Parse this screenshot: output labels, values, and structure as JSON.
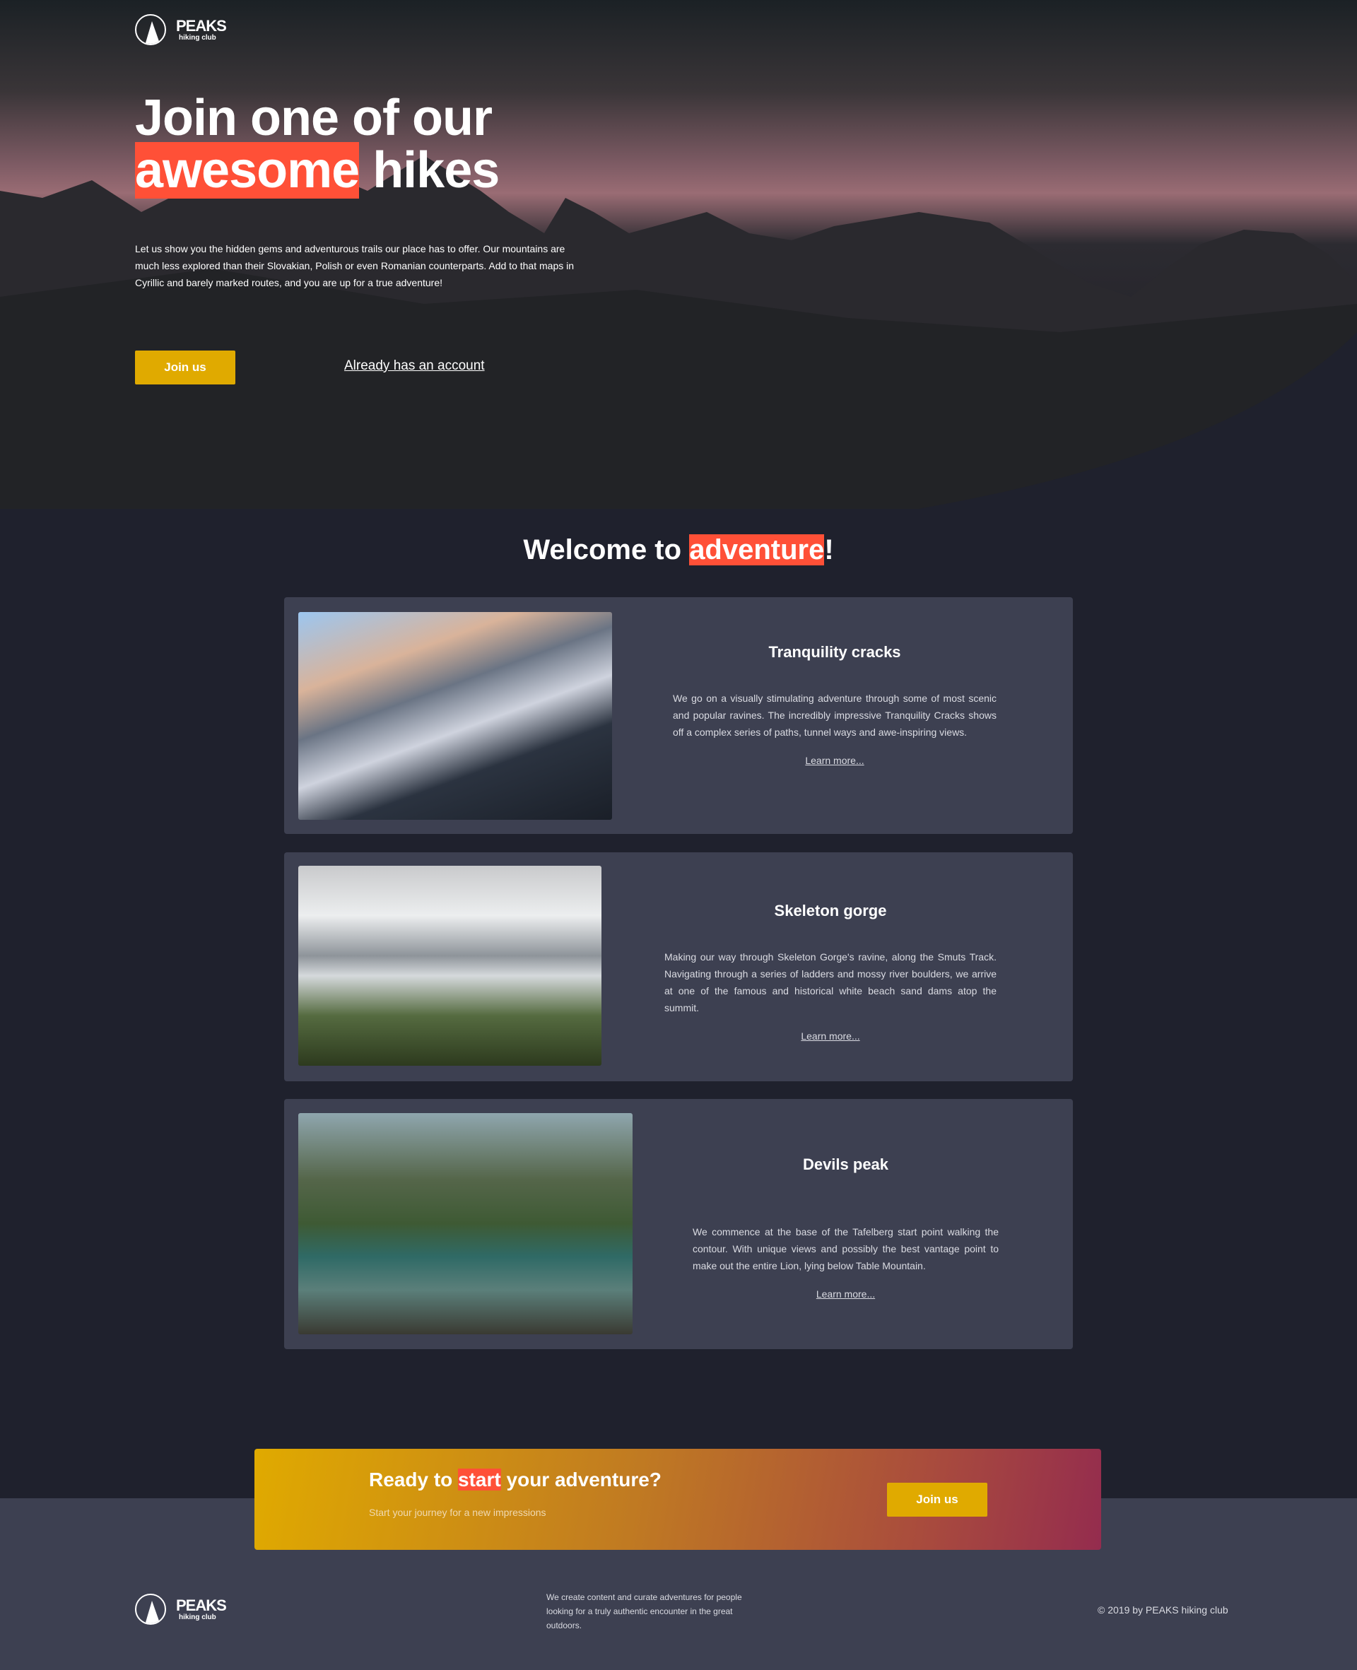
{
  "brand": {
    "name": "PEAKS",
    "tagline": "hiking club"
  },
  "hero": {
    "title_line1": "Join one of our",
    "title_highlight": "awesome",
    "title_rest": " hikes",
    "description": "Let us show you the hidden gems and adventurous trails our place has to offer. Our mountains are much less explored than their Slovakian, Polish or even Romanian counterparts. Add to that maps in Cyrillic and barely marked routes, and you are up for a true adventure!",
    "join_label": "Join us",
    "account_label": "Already has an account"
  },
  "welcome": {
    "pre": "Welcome to ",
    "highlight": "adventure",
    "post": "!"
  },
  "hikes": [
    {
      "title": "Tranquility cracks",
      "description": "We go on a visually stimulating adventure through some of most scenic and popular ravines. The incredibly impressive Tranquility Cracks shows off a complex series of paths, tunnel ways and awe-inspiring views.",
      "link": "Learn more..."
    },
    {
      "title": "Skeleton gorge",
      "description": "Making our way through Skeleton Gorge's ravine, along the Smuts Track. Navigating through a series of ladders and mossy river boulders, we arrive at one of the famous and historical white beach sand dams atop the summit.",
      "link": "Learn more..."
    },
    {
      "title": "Devils peak",
      "description": "We commence at the base of the Tafelberg start point walking the contour. With unique views and possibly the best vantage point to make out the entire Lion, lying below Table Mountain.",
      "link": "Learn more..."
    }
  ],
  "cta": {
    "pre": "Ready to ",
    "highlight": "start",
    "post": " your adventure?",
    "subtitle": "Start your journey for a new impressions",
    "join_label": "Join us"
  },
  "footer": {
    "about": "We create content and curate adventures for people looking for a truly authentic encounter in the great outdoors.",
    "copyright": "© 2019 by PEAKS hiking club"
  },
  "colors": {
    "accent": "#ff5037",
    "button": "#e0aa00",
    "background": "#1f212d",
    "card": "#3d4051"
  }
}
